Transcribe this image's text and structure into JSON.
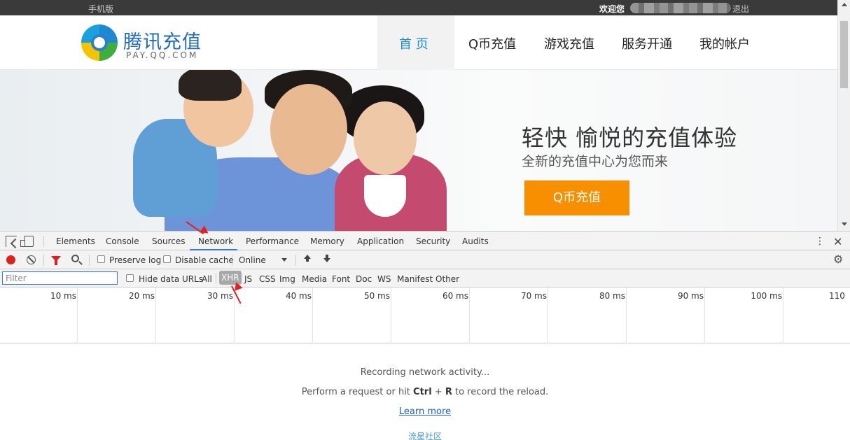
{
  "site": {
    "topbar": {
      "mobile": "手机版",
      "welcome": "欢迎您",
      "logout": "退出"
    },
    "logo": {
      "title": "腾讯充值",
      "subtitle": "PAY.QQ.COM"
    },
    "nav": [
      {
        "label": "首 页",
        "active": true
      },
      {
        "label": "Q币充值",
        "active": false
      },
      {
        "label": "游戏充值",
        "active": false
      },
      {
        "label": "服务开通",
        "active": false
      },
      {
        "label": "我的帐户",
        "active": false
      }
    ],
    "hero": {
      "title": "轻快 愉悦的充值体验",
      "subtitle": "全新的充值中心为您而来",
      "button": "Q币充值",
      "button_color": "#f88f00"
    }
  },
  "devtools": {
    "tabs": [
      "Elements",
      "Console",
      "Sources",
      "Network",
      "Performance",
      "Memory",
      "Application",
      "Security",
      "Audits"
    ],
    "active_tab": "Network",
    "toolbar": {
      "preserve_log": "Preserve log",
      "disable_cache": "Disable cache",
      "throttle": "Online"
    },
    "filterbar": {
      "placeholder": "Filter",
      "hide_data_urls": "Hide data URLs",
      "types": [
        "All",
        "XHR",
        "JS",
        "CSS",
        "Img",
        "Media",
        "Font",
        "Doc",
        "WS",
        "Manifest",
        "Other"
      ],
      "active_type": "XHR"
    },
    "timeline_ticks": [
      "10 ms",
      "20 ms",
      "30 ms",
      "40 ms",
      "50 ms",
      "60 ms",
      "70 ms",
      "80 ms",
      "90 ms",
      "100 ms",
      "110"
    ],
    "empty": {
      "recording": "Recording network activity...",
      "hint_prefix": "Perform a request or hit ",
      "hint_key1": "Ctrl",
      "hint_plus": " + ",
      "hint_key2": "R",
      "hint_suffix": " to record the reload.",
      "learn_more": "Learn more"
    },
    "watermark": "流星社区",
    "accent_color": "#3879d9"
  }
}
